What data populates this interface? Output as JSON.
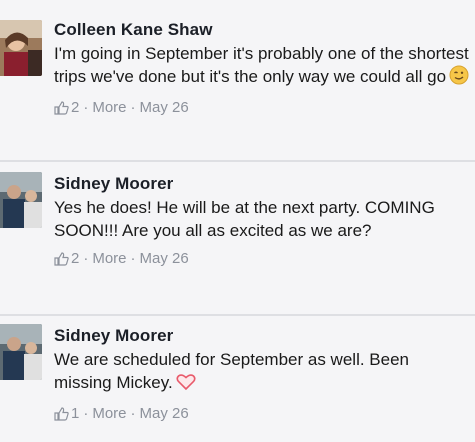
{
  "comments": [
    {
      "author": "Colleen Kane Shaw",
      "text": "I'm going in September it's probably one of the shortest trips we've done but it's the only way we could all go",
      "emoji": "smiley-wink-icon",
      "likes": "2",
      "more": "More",
      "date": "May 26"
    },
    {
      "author": "Sidney Moorer",
      "text": "Yes he does! He will be at the next party. COMING SOON!!! Are you all as excited as we are?",
      "likes": "2",
      "more": "More",
      "date": "May 26"
    },
    {
      "author": "Sidney Moorer",
      "text": "We are scheduled for September as well. Been missing Mickey.",
      "emoji": "heart-icon",
      "likes": "1",
      "more": "More",
      "date": "May 26"
    }
  ],
  "separator": "·",
  "colors": {
    "background": "#f5f5f7",
    "author": "#1b1f27",
    "meta": "#8c919b",
    "divider": "#dedfe3",
    "heart": "#e85a6b",
    "emoji": "#f6c648"
  }
}
